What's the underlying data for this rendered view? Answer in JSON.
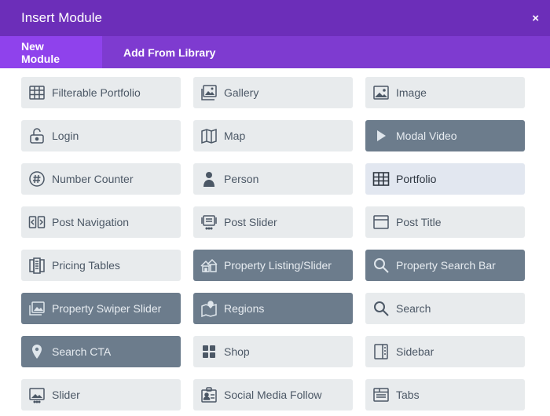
{
  "header": {
    "title": "Insert Module",
    "close_label": "×"
  },
  "tabs": [
    {
      "label": "New Module",
      "active": true
    },
    {
      "label": "Add From Library",
      "active": false
    }
  ],
  "colors": {
    "header_bg": "#6c2eb9",
    "tabbar_bg": "#7e3bd0",
    "active_tab_bg": "#8f42ec",
    "item_bg": "#e8ebed",
    "item_dark_bg": "#6c7c8c",
    "item_text": "#4c5866"
  },
  "modules": [
    {
      "label": "Filterable Portfolio",
      "icon": "filterable-portfolio-icon"
    },
    {
      "label": "Gallery",
      "icon": "gallery-icon"
    },
    {
      "label": "Image",
      "icon": "image-icon"
    },
    {
      "label": "Login",
      "icon": "login-lock-icon"
    },
    {
      "label": "Map",
      "icon": "map-icon"
    },
    {
      "label": "Modal Video",
      "icon": "play-icon",
      "style": "dark"
    },
    {
      "label": "Number Counter",
      "icon": "number-counter-icon"
    },
    {
      "label": "Person",
      "icon": "person-icon"
    },
    {
      "label": "Portfolio",
      "icon": "portfolio-grid-icon",
      "style": "selected"
    },
    {
      "label": "Post Navigation",
      "icon": "post-navigation-icon"
    },
    {
      "label": "Post Slider",
      "icon": "post-slider-icon"
    },
    {
      "label": "Post Title",
      "icon": "post-title-icon"
    },
    {
      "label": "Pricing Tables",
      "icon": "pricing-tables-icon"
    },
    {
      "label": "Property Listing/Slider",
      "icon": "property-listing-icon",
      "style": "dark"
    },
    {
      "label": "Property Search Bar",
      "icon": "search-icon",
      "style": "dark"
    },
    {
      "label": "Property Swiper Slider",
      "icon": "swiper-slider-icon",
      "style": "dark"
    },
    {
      "label": "Regions",
      "icon": "regions-map-icon",
      "style": "dark"
    },
    {
      "label": "Search",
      "icon": "search-icon"
    },
    {
      "label": "Search CTA",
      "icon": "map-pin-icon",
      "style": "dark"
    },
    {
      "label": "Shop",
      "icon": "shop-grid-icon"
    },
    {
      "label": "Sidebar",
      "icon": "sidebar-icon"
    },
    {
      "label": "Slider",
      "icon": "slider-icon"
    },
    {
      "label": "Social Media Follow",
      "icon": "social-follow-icon"
    },
    {
      "label": "Tabs",
      "icon": "tabs-icon"
    }
  ]
}
